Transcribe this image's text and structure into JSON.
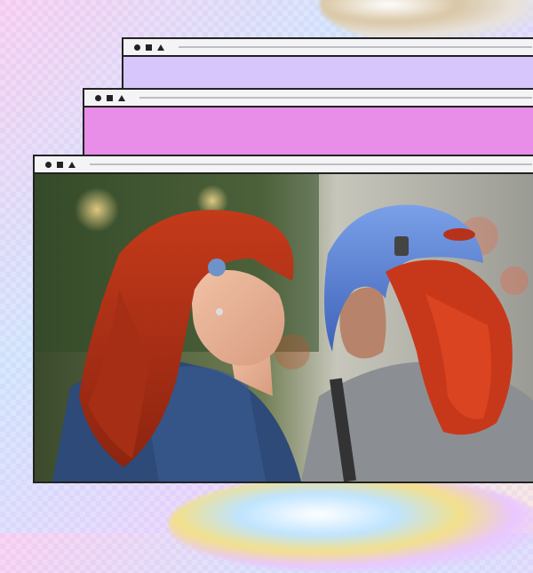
{
  "background": {
    "style": "holographic-pattern",
    "accent_colors": [
      "#e6dcf6",
      "#ffbeec",
      "#bee2ff"
    ]
  },
  "windows": [
    {
      "id": "back",
      "controls": [
        "circle-icon",
        "square-icon",
        "triangle-icon"
      ],
      "fill_color": "#d7c6fb"
    },
    {
      "id": "middle",
      "controls": [
        "circle-icon",
        "square-icon",
        "triangle-icon"
      ],
      "fill_color": "#e88de8"
    },
    {
      "id": "front",
      "controls": [
        "circle-icon",
        "square-icon",
        "triangle-icon"
      ],
      "image": "two-women-red-and-blue-hair-portrait"
    }
  ]
}
